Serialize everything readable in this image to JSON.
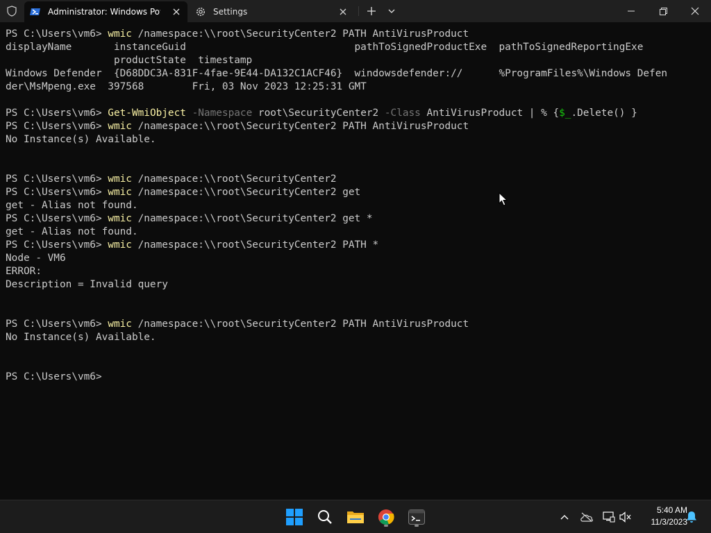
{
  "window": {
    "tabs": [
      {
        "title": "Administrator: Windows PowerShell",
        "active": true
      },
      {
        "title": "Settings",
        "active": false
      }
    ],
    "icons": {
      "shield": "shield-icon",
      "powershell": "powershell-icon",
      "settings": "gear-icon",
      "new_tab": "plus-icon",
      "dropdown": "chevron-down-icon",
      "minimize": "minimize-icon",
      "maximize": "restore-icon",
      "close": "close-icon"
    }
  },
  "terminal": {
    "colors": {
      "background": "#0c0c0c",
      "text": "#cccccc",
      "command": "#f9f1a5",
      "parameter": "#767676",
      "variable": "#16c60c"
    },
    "lines": [
      [
        {
          "t": "PS C:\\Users\\vm6> ",
          "c": "prompt"
        },
        {
          "t": "wmic",
          "c": "cmd"
        },
        {
          "t": " /namespace:\\\\root\\SecurityCenter2 PATH AntiVirusProduct",
          "c": "arg"
        }
      ],
      [
        {
          "t": "displayName       instanceGuid                            pathToSignedProductExe  pathToSignedReportingExe",
          "c": "out"
        }
      ],
      [
        {
          "t": "                  productState  timestamp",
          "c": "out"
        }
      ],
      [
        {
          "t": "Windows Defender  {D68DDC3A-831F-4fae-9E44-DA132C1ACF46}  windowsdefender://      %ProgramFiles%\\Windows Defen",
          "c": "out"
        }
      ],
      [
        {
          "t": "der\\MsMpeng.exe  397568        Fri, 03 Nov 2023 12:25:31 GMT",
          "c": "out"
        }
      ],
      [],
      [
        {
          "t": "PS C:\\Users\\vm6> ",
          "c": "prompt"
        },
        {
          "t": "Get-WmiObject",
          "c": "cmd"
        },
        {
          "t": " -Namespace",
          "c": "param"
        },
        {
          "t": " root\\SecurityCenter2",
          "c": "arg"
        },
        {
          "t": " -Class",
          "c": "param"
        },
        {
          "t": " AntiVirusProduct | % {",
          "c": "arg"
        },
        {
          "t": "$_",
          "c": "var"
        },
        {
          "t": ".Delete() }",
          "c": "arg"
        }
      ],
      [
        {
          "t": "PS C:\\Users\\vm6> ",
          "c": "prompt"
        },
        {
          "t": "wmic",
          "c": "cmd"
        },
        {
          "t": " /namespace:\\\\root\\SecurityCenter2 PATH AntiVirusProduct",
          "c": "arg"
        }
      ],
      [
        {
          "t": "No Instance(s) Available.",
          "c": "out"
        }
      ],
      [],
      [],
      [
        {
          "t": "PS C:\\Users\\vm6> ",
          "c": "prompt"
        },
        {
          "t": "wmic",
          "c": "cmd"
        },
        {
          "t": " /namespace:\\\\root\\SecurityCenter2",
          "c": "arg"
        }
      ],
      [
        {
          "t": "PS C:\\Users\\vm6> ",
          "c": "prompt"
        },
        {
          "t": "wmic",
          "c": "cmd"
        },
        {
          "t": " /namespace:\\\\root\\SecurityCenter2 get",
          "c": "arg"
        }
      ],
      [
        {
          "t": "get - Alias not found.",
          "c": "out"
        }
      ],
      [
        {
          "t": "PS C:\\Users\\vm6> ",
          "c": "prompt"
        },
        {
          "t": "wmic",
          "c": "cmd"
        },
        {
          "t": " /namespace:\\\\root\\SecurityCenter2 get *",
          "c": "arg"
        }
      ],
      [
        {
          "t": "get - Alias not found.",
          "c": "out"
        }
      ],
      [
        {
          "t": "PS C:\\Users\\vm6> ",
          "c": "prompt"
        },
        {
          "t": "wmic",
          "c": "cmd"
        },
        {
          "t": " /namespace:\\\\root\\SecurityCenter2 PATH *",
          "c": "arg"
        }
      ],
      [
        {
          "t": "Node - VM6",
          "c": "out"
        }
      ],
      [
        {
          "t": "ERROR:",
          "c": "out"
        }
      ],
      [
        {
          "t": "Description = Invalid query",
          "c": "out"
        }
      ],
      [],
      [],
      [
        {
          "t": "PS C:\\Users\\vm6> ",
          "c": "prompt"
        },
        {
          "t": "wmic",
          "c": "cmd"
        },
        {
          "t": " /namespace:\\\\root\\SecurityCenter2 PATH AntiVirusProduct",
          "c": "arg"
        }
      ],
      [
        {
          "t": "No Instance(s) Available.",
          "c": "out"
        }
      ],
      [],
      [],
      [
        {
          "t": "PS C:\\Users\\vm6> ",
          "c": "prompt"
        }
      ]
    ]
  },
  "taskbar": {
    "apps": [
      {
        "name": "start-icon",
        "running": false
      },
      {
        "name": "search-icon",
        "running": false
      },
      {
        "name": "file-explorer-icon",
        "running": false
      },
      {
        "name": "chrome-icon",
        "running": true
      },
      {
        "name": "terminal-icon",
        "running": true
      }
    ],
    "tray": [
      "chevron-up-icon",
      "onedrive-offline-icon",
      "network-icon",
      "volume-muted-icon"
    ],
    "clock": {
      "time": "5:40 AM",
      "date": "11/3/2023"
    },
    "notification_icon": "bell-icon"
  }
}
